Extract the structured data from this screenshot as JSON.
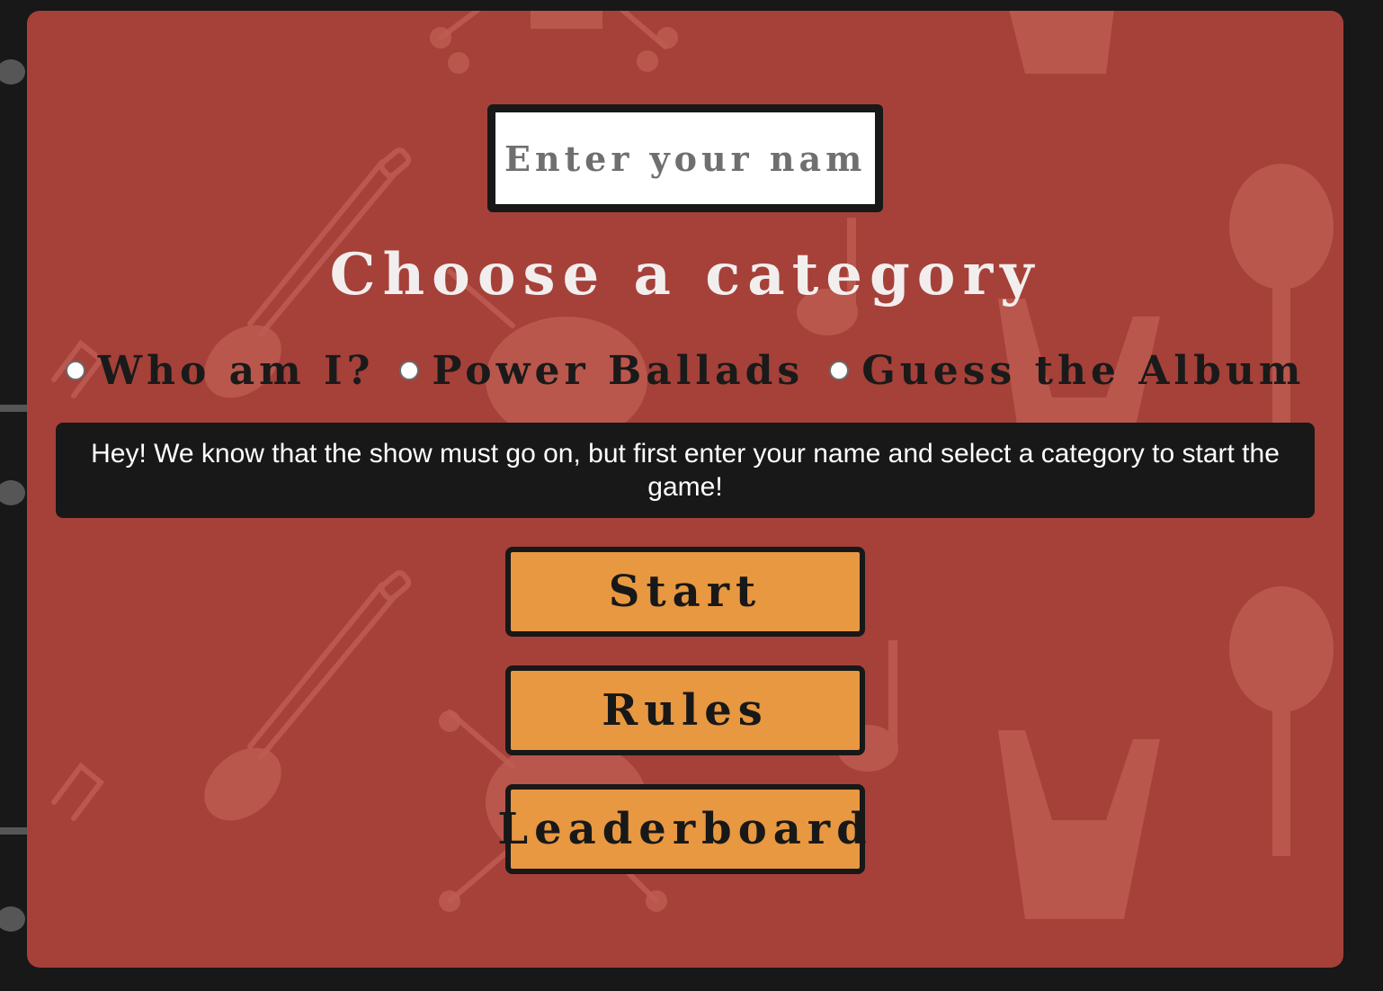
{
  "name_input": {
    "placeholder": "Enter your name",
    "value": ""
  },
  "category_section": {
    "heading": "Choose a category",
    "options": [
      {
        "label": "Who am I?",
        "selected": false
      },
      {
        "label": "Power Ballads",
        "selected": false
      },
      {
        "label": "Guess the Album",
        "selected": false
      }
    ]
  },
  "message": "Hey! We know that the show must go on, but first enter your name and select a category to start the game!",
  "buttons": {
    "start": "Start",
    "rules": "Rules",
    "leaderboard": "Leaderboard"
  },
  "colors": {
    "page_background": "#181818",
    "panel_background": "#a54139",
    "decor": "#bd5b52",
    "button_background": "#e89840",
    "heading_text": "#f3eeee",
    "message_background": "#181818"
  },
  "background_icons": [
    "guitar-icon",
    "skull-icon",
    "crossbones-icon",
    "music-note-icon",
    "microphone-icon",
    "rock-hand-icon"
  ]
}
